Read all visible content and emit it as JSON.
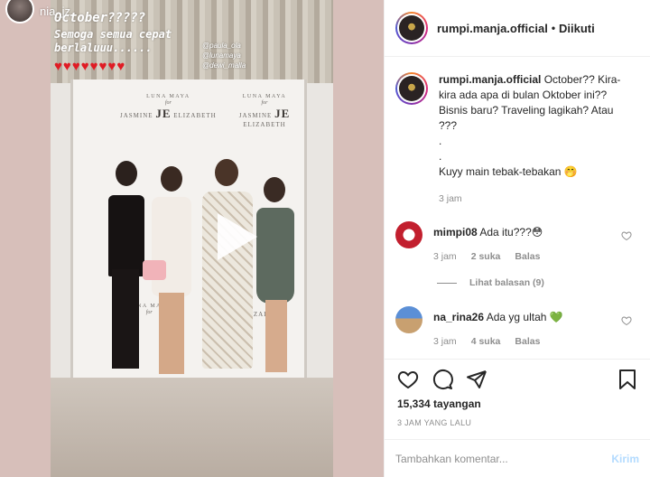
{
  "story": {
    "username": "nia_jz",
    "line1": "October?????",
    "line2": "Semoga semua cepat berlaluuu......",
    "hearts": 8,
    "tags": [
      "@paula_ola",
      "@lunamaya",
      "@dewi_malla"
    ]
  },
  "backdrop": {
    "brand_top": "LUNA MAYA",
    "brand_for": "for",
    "brand_bottom": "JASMINE",
    "brand_bottom2": "ELIZABETH",
    "brand_mono": "JE"
  },
  "post": {
    "username": "rumpi.manja.official",
    "separator": "•",
    "follow_state": "Diikuti",
    "caption_lines": [
      "October?? Kira-kira ada apa di bulan Oktober ini?? Bisnis baru? Traveling lagikah? Atau ???",
      ".",
      ".",
      "Kuyy main tebak-tebakan 🤭"
    ],
    "caption_time": "3 jam"
  },
  "comments": [
    {
      "username": "mimpi08",
      "text": "Ada itu???😳",
      "time": "3 jam",
      "likes": "2 suka",
      "reply": "Balas",
      "view_replies": "Lihat balasan (9)"
    },
    {
      "username": "na_rina26",
      "text": "Ada yg ultah 💚",
      "time": "3 jam",
      "likes": "4 suka",
      "reply": "Balas"
    }
  ],
  "stats": {
    "views": "15,334 tayangan",
    "posted": "3 JAM YANG LALU"
  },
  "composer": {
    "placeholder": "Tambahkan komentar...",
    "post_label": "Kirim"
  },
  "colors": {
    "link": "#262626",
    "muted": "#8e8e8e",
    "post_disabled": "#b3dbff",
    "heart_red": "#e01b24",
    "green_heart": "#2ecc40"
  }
}
